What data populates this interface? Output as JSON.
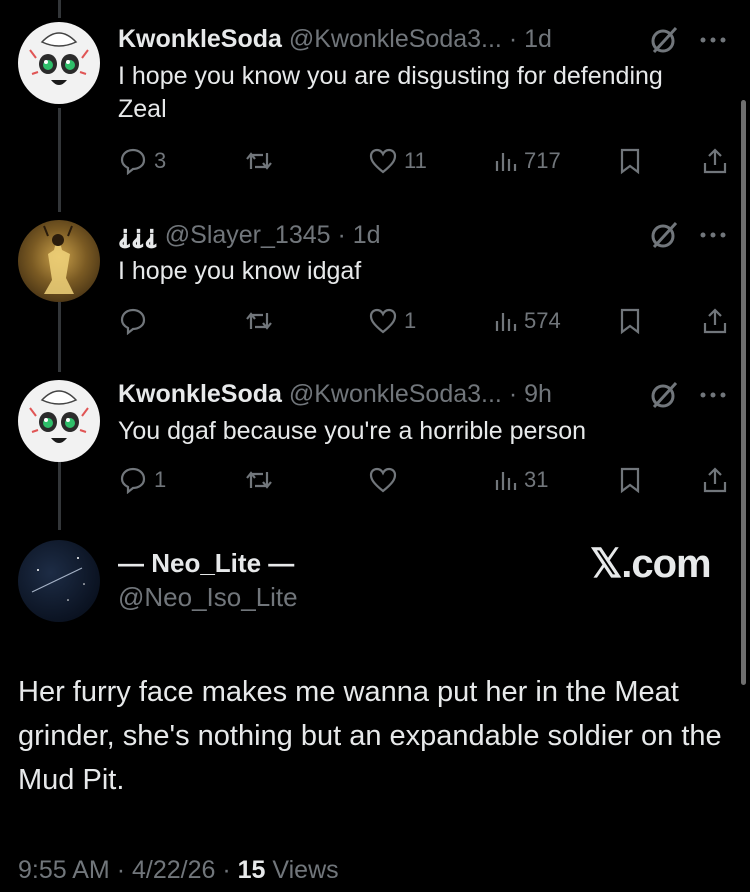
{
  "replies": [
    {
      "name": "KwonkleSoda",
      "handle": "@KwonkleSoda3...",
      "time": "1d",
      "text": "I hope you know you are disgusting for defending Zeal",
      "replies": "3",
      "retweets": "",
      "likes": "11",
      "views": "717",
      "avatar_icon": "cartoon-face-avatar"
    },
    {
      "name": "⸘⸘⸘",
      "handle": "@Slayer_1345",
      "time": "1d",
      "text": "I hope you know idgaf",
      "replies": "",
      "retweets": "",
      "likes": "1",
      "views": "574",
      "avatar_icon": "golden-figure-avatar"
    },
    {
      "name": "KwonkleSoda",
      "handle": "@KwonkleSoda3...",
      "time": "9h",
      "text": "You dgaf because you're a horrible person",
      "replies": "1",
      "retweets": "",
      "likes": "",
      "views": "31",
      "avatar_icon": "cartoon-face-avatar"
    }
  ],
  "quoted": {
    "name": "— Neo_Lite —",
    "handle": "@Neo_Iso_Lite",
    "site": "𝕏.com",
    "text": "Her furry face makes me wanna put her in the Meat grinder, she's nothing but an expandable soldier on the Mud Pit.",
    "avatar_icon": "night-sky-avatar"
  },
  "footer": {
    "time": "9:55 AM",
    "date": "4/22/26",
    "views_count": "15",
    "views_label": "Views"
  },
  "colors": {
    "background": "#000000",
    "text": "#e7e9ea",
    "secondary": "#71767b",
    "thread_line": "#333639"
  }
}
